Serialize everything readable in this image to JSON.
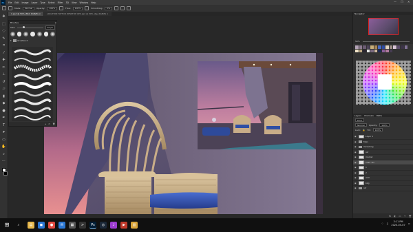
{
  "app": {
    "logo": "Ps",
    "menu": [
      "File",
      "Edit",
      "Image",
      "Layer",
      "Type",
      "Select",
      "Filter",
      "3D",
      "View",
      "Window",
      "Help"
    ],
    "window_controls": [
      "—",
      "❐",
      "✕"
    ]
  },
  "options_bar": {
    "mode_label": "Mode:",
    "mode_value": "Normal",
    "opacity_label": "Opacity:",
    "opacity_value": "100%",
    "flow_label": "Flow:",
    "flow_value": "100%",
    "smoothing_label": "Smoothing:",
    "smoothing_value": "0%"
  },
  "tabs": [
    {
      "label": "1.psd @ 50% (Mid, RGB/8) ×",
      "active": true
    },
    {
      "label": "LOCATION TATTOO DESKTOP UPS.psd @ 50% (bg, RGB/8) ×",
      "active": false
    }
  ],
  "brushes_panel": {
    "title": "Brushes",
    "size_label": "Size:",
    "size_value": "30 px",
    "folder_label": "brushes 2",
    "footer_icons": [
      "+",
      "▭",
      "🗑"
    ]
  },
  "navigator": {
    "tabs": [
      "Navigator"
    ],
    "zoom": "50%"
  },
  "swatches": {
    "colors": [
      "#b5a3b8",
      "#8e7c92",
      "#6b5c73",
      "#4d4358",
      "#c9b07a",
      "#a88656",
      "#4a6cc4",
      "#2c4aa0",
      "#e0d3c2",
      "#9c8e86",
      "#d8c4d8",
      "#5c4c6c",
      "#3c3448",
      "#817396",
      "#f2e4c8",
      "#bfa983",
      "#2a2530",
      "#e6e6e6",
      "#7a6a80",
      "#cfb8a2",
      "#1e2a55",
      "#8b5e9a",
      "#b07aa0",
      "#463c52"
    ]
  },
  "layers_panel": {
    "tabs": [
      "Layers",
      "Channels",
      "Paths"
    ],
    "kind_label": "Kind",
    "blend_mode": "Normal",
    "opacity_label": "Opacity:",
    "opacity_value": "100%",
    "lock_label": "Lock:",
    "fill_label": "Fill:",
    "fill_value": "100%",
    "layers": [
      {
        "name": "Layer 1",
        "type": "layer",
        "selected": false
      },
      {
        "name": "Main",
        "type": "folder",
        "selected": false
      },
      {
        "name": "Vanishing",
        "type": "folder",
        "selected": false
      },
      {
        "name": "ref",
        "type": "layer",
        "selected": false
      },
      {
        "name": "marker",
        "type": "layer",
        "selected": false
      },
      {
        "name": "chair 3D",
        "type": "layer",
        "selected": true
      },
      {
        "name": "1",
        "type": "layer",
        "selected": false
      },
      {
        "name": "2",
        "type": "layer",
        "selected": false
      },
      {
        "name": "wall",
        "type": "layer",
        "selected": false
      },
      {
        "name": "bkg",
        "type": "layer",
        "selected": false
      },
      {
        "name": "ref",
        "type": "folder",
        "selected": false
      }
    ],
    "footer_icons": [
      "fx",
      "◐",
      "▭",
      "+",
      "🗑"
    ]
  },
  "taskbar": {
    "apps": [
      {
        "name": "file-explorer",
        "glyph": "▤",
        "color": "#e8b84b"
      },
      {
        "name": "store",
        "glyph": "◼",
        "color": "#2b77d4"
      },
      {
        "name": "chrome",
        "glyph": "●",
        "color": "#e04a3f"
      },
      {
        "name": "mail",
        "glyph": "✉",
        "color": "#2b77d4"
      },
      {
        "name": "calculator",
        "glyph": "▦",
        "color": "#555555"
      },
      {
        "name": "terminal",
        "glyph": ">",
        "color": "#333333"
      },
      {
        "name": "photoshop",
        "glyph": "Ps",
        "color": "#001e36"
      },
      {
        "name": "steam",
        "glyph": "◎",
        "color": "#1b2838"
      },
      {
        "name": "music",
        "glyph": "♪",
        "color": "#9b3dd1"
      },
      {
        "name": "video",
        "glyph": "▶",
        "color": "#c0392b"
      },
      {
        "name": "folder",
        "glyph": "▥",
        "color": "#d9a43a"
      }
    ],
    "time": "3:11 PM",
    "date": "2020-05-07"
  }
}
